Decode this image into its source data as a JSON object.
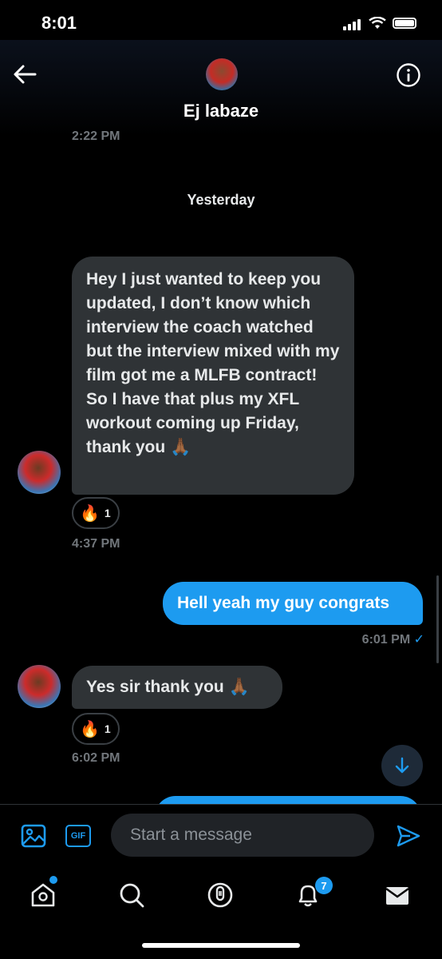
{
  "status_bar": {
    "time": "8:01"
  },
  "header": {
    "name": "Ej labaze",
    "previous_time": "2:22 PM"
  },
  "day_separator": "Yesterday",
  "messages": [
    {
      "direction": "incoming",
      "text": "Hey I just wanted to keep you updated, I don’t know which interview the coach watched but the interview mixed with my film got me a MLFB contract! So I have that plus my XFL workout coming up Friday, thank you 🙏🏾",
      "reaction": {
        "emoji": "🔥",
        "count": "1"
      },
      "time": "4:37 PM"
    },
    {
      "direction": "outgoing",
      "text": "Hell yeah my guy congrats",
      "time": "6:01 PM",
      "status": "✓"
    },
    {
      "direction": "incoming",
      "text": "Yes sir thank you 🙏🏾",
      "reaction": {
        "emoji": "🔥",
        "count": "1"
      },
      "time": "6:02 PM"
    }
  ],
  "composer": {
    "gif_label": "GIF",
    "placeholder": "Start a message"
  },
  "tab_bar": {
    "notifications_badge": "7"
  },
  "colors": {
    "accent": "#1d9bf0",
    "incoming_bubble": "#2f3336",
    "background": "#000000"
  }
}
